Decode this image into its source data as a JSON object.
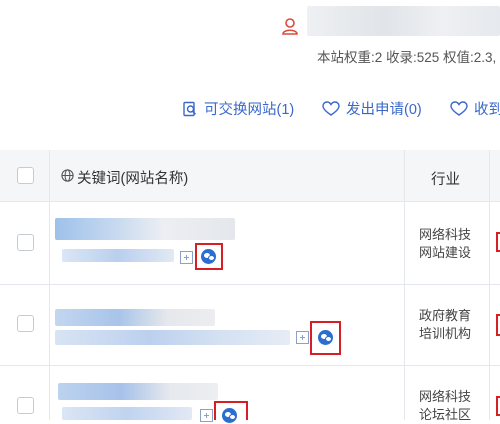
{
  "header": {
    "user_icon": "user-icon",
    "site_stats": "本站权重:2 收录:525 权值:2.3,"
  },
  "tabs": [
    {
      "label": "可交换网站(1)",
      "icon": "search-document-icon"
    },
    {
      "label": "发出申请(0)",
      "icon": "heart-outline-icon"
    },
    {
      "label": "收到",
      "icon": "heart-outline-icon"
    }
  ],
  "table": {
    "headers": {
      "keyword": "关键词(网站名称)",
      "industry": "行业",
      "keyword_icon": "globe-icon"
    },
    "rows": [
      {
        "industry_line1": "网络科技",
        "industry_line2": "网站建设"
      },
      {
        "industry_line1": "政府教育",
        "industry_line2": "培训机构"
      },
      {
        "industry_line1": "网络科技",
        "industry_line2": "论坛社区"
      }
    ]
  },
  "colors": {
    "accent": "#3a68c9",
    "highlight": "#d51f24",
    "header_bg": "#f5f6f8",
    "border": "#e4e7ec"
  }
}
